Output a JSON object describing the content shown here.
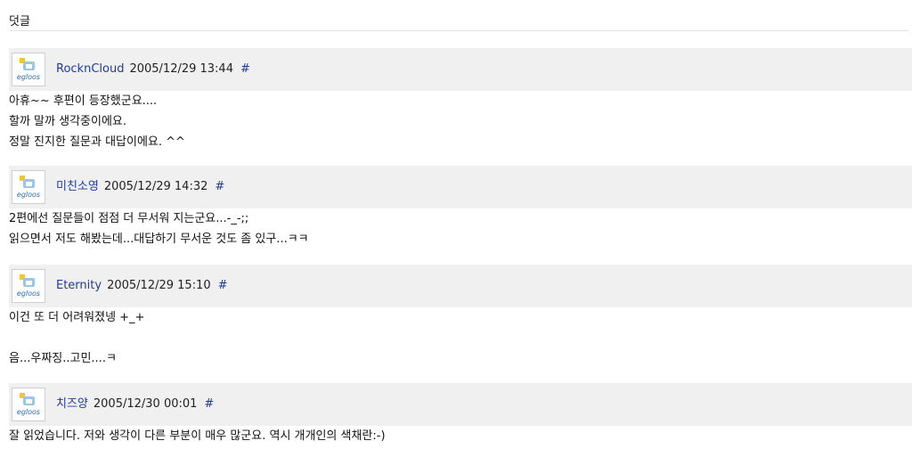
{
  "section": {
    "title": "덧글"
  },
  "comments": [
    {
      "avatar_icon": "egloos-avatar-icon",
      "avatar_text": "egloos",
      "author": "RocknCloud",
      "date": "2005/12/29 13:44",
      "permalink": "#",
      "lines": [
        "아휴~~ 후편이 등장했군요....",
        "할까 말까 생각중이에요.",
        "정말 진지한 질문과 대답이에요. ^^"
      ]
    },
    {
      "avatar_icon": "egloos-avatar-icon",
      "avatar_text": "egloos",
      "author": "미친소영",
      "date": "2005/12/29 14:32",
      "permalink": "#",
      "lines": [
        "2편에선 질문들이 점점 더 무서워 지는군요...-_-;;",
        "읽으면서 저도 해봤는데...대답하기 무서운 것도 좀 있구...ㅋㅋ"
      ]
    },
    {
      "avatar_icon": "egloos-avatar-icon",
      "avatar_text": "egloos",
      "author": "Eternity",
      "date": "2005/12/29 15:10",
      "permalink": "#",
      "lines": [
        "이건 또 더 어려워졌넹 +_+",
        "",
        "음...우짜징..고민....ㅋ"
      ]
    },
    {
      "avatar_icon": "egloos-avatar-icon",
      "avatar_text": "egloos",
      "author": "치즈양",
      "date": "2005/12/30 00:01",
      "permalink": "#",
      "lines": [
        "잘 읽었습니다. 저와 생각이 다른 부분이 매우 많군요. 역시 개개인의 색채란:-)"
      ]
    }
  ],
  "colors": {
    "header_bg": "#f0f0f0",
    "link": "#1f3c9c",
    "text": "#111111"
  }
}
